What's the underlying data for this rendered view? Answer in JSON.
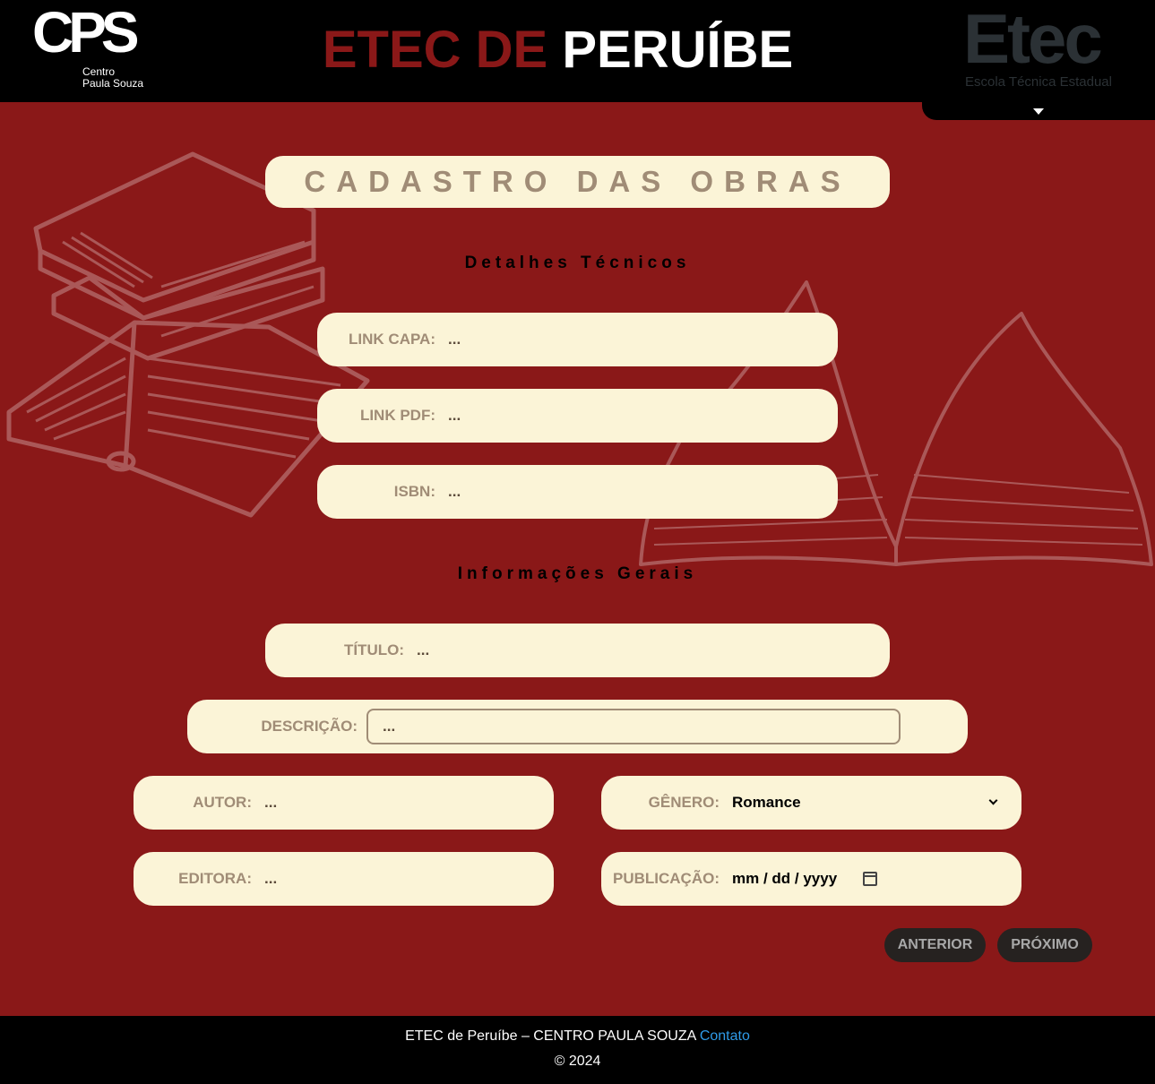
{
  "header": {
    "cps_logo_letters": "CPS",
    "cps_logo_sub1": "Centro",
    "cps_logo_sub2": "Paula Souza",
    "title_part1": "ETEC DE",
    "title_part2": "PERUÍBE",
    "etec_logo_big": "Etec",
    "etec_logo_small": "Escola Técnica Estadual"
  },
  "form": {
    "title": "CADASTRO DAS OBRAS",
    "section_tech": "Detalhes Técnicos",
    "section_general": "Informações Gerais",
    "link_capa": {
      "label": "LINK CAPA:",
      "value": "..."
    },
    "link_pdf": {
      "label": "LINK PDF:",
      "value": "..."
    },
    "isbn": {
      "label": "ISBN:",
      "value": "..."
    },
    "titulo": {
      "label": "TÍTULO:",
      "value": "..."
    },
    "descricao": {
      "label": "DESCRIÇÃO:",
      "value": "..."
    },
    "autor": {
      "label": "AUTOR:",
      "value": "..."
    },
    "genero": {
      "label": "GÊNERO:",
      "value": "Romance"
    },
    "editora": {
      "label": "EDITORA:",
      "value": "..."
    },
    "publicacao": {
      "label": "PUBLICAÇÃO:",
      "value": "mm / dd / yyyy"
    }
  },
  "buttons": {
    "anterior": "ANTERIOR",
    "proximo": "PRÓXIMO"
  },
  "footer": {
    "text": "ETEC de Peruíbe – CENTRO PAULA SOUZA",
    "link": "Contato",
    "copyright": "© 2024"
  }
}
